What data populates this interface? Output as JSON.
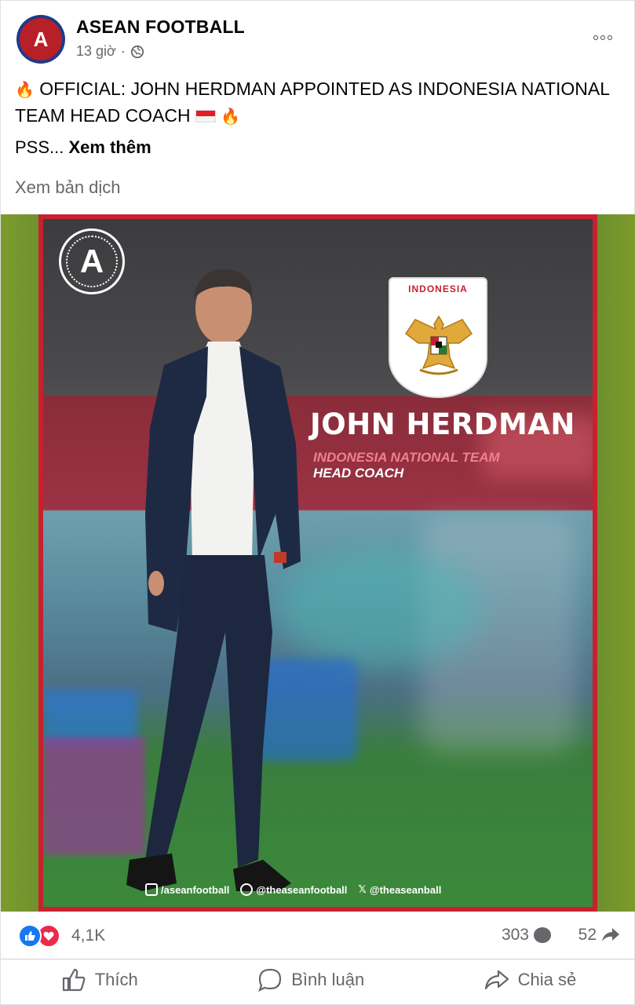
{
  "post": {
    "page_name": "ASEAN FOOTBALL",
    "time": "13 giờ",
    "separator": "·",
    "avatar_letter": "A",
    "text_line": "OFFICIAL: JOHN HERDMAN APPOINTED AS INDONESIA NATIONAL TEAM HEAD COACH",
    "pss": "PSS...",
    "see_more": "Xem thêm",
    "translate": "Xem bản dịch"
  },
  "graphic": {
    "logo_letter": "A",
    "crest_label": "INDONESIA",
    "name": "JOHN HERDMAN",
    "subtitle_1": "INDONESIA NATIONAL TEAM",
    "subtitle_2": "HEAD COACH",
    "social_1": "/aseanfootball",
    "social_2": "@theaseanfootball",
    "social_3": "@theaseanball"
  },
  "stats": {
    "reactions": "4,1K",
    "comments": "303",
    "shares": "52"
  },
  "actions": {
    "like": "Thích",
    "comment": "Bình luận",
    "share": "Chia sẻ"
  },
  "colors": {
    "accent_red": "#c8202e",
    "like_blue": "#1877f2",
    "love_red": "#f0284a",
    "muted": "#65676b"
  }
}
